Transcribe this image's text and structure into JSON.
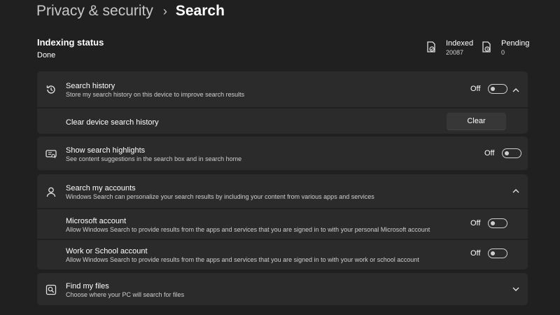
{
  "breadcrumb": {
    "parent": "Privacy & security",
    "separator": "›",
    "current": "Search"
  },
  "indexing": {
    "title": "Indexing status",
    "value": "Done",
    "indexed_label": "Indexed",
    "indexed_count": "20087",
    "pending_label": "Pending",
    "pending_count": "0"
  },
  "search_history": {
    "title": "Search history",
    "description": "Store my search history on this device to improve search results",
    "toggle_label": "Off",
    "toggle_on": false,
    "icon": "history-icon",
    "clear_row": {
      "title": "Clear device search history",
      "button_label": "Clear"
    }
  },
  "highlights": {
    "title": "Show search highlights",
    "description": "See content suggestions in the search box and in search home",
    "toggle_label": "Off",
    "toggle_on": false,
    "icon": "highlights-icon"
  },
  "accounts": {
    "title": "Search my accounts",
    "description": "Windows Search can personalize your search results by including your content from various apps and services",
    "icon": "person-icon",
    "microsoft": {
      "title": "Microsoft account",
      "description": "Allow Windows Search to provide results from the apps and services that you are signed in to with your personal Microsoft account",
      "toggle_label": "Off",
      "toggle_on": false
    },
    "work": {
      "title": "Work or School account",
      "description": "Allow Windows Search to provide results from the apps and services that you are signed in to with your work or school account",
      "toggle_label": "Off",
      "toggle_on": false
    }
  },
  "find_files": {
    "title": "Find my files",
    "description": "Choose where your PC will search for files",
    "icon": "find-files-icon"
  }
}
